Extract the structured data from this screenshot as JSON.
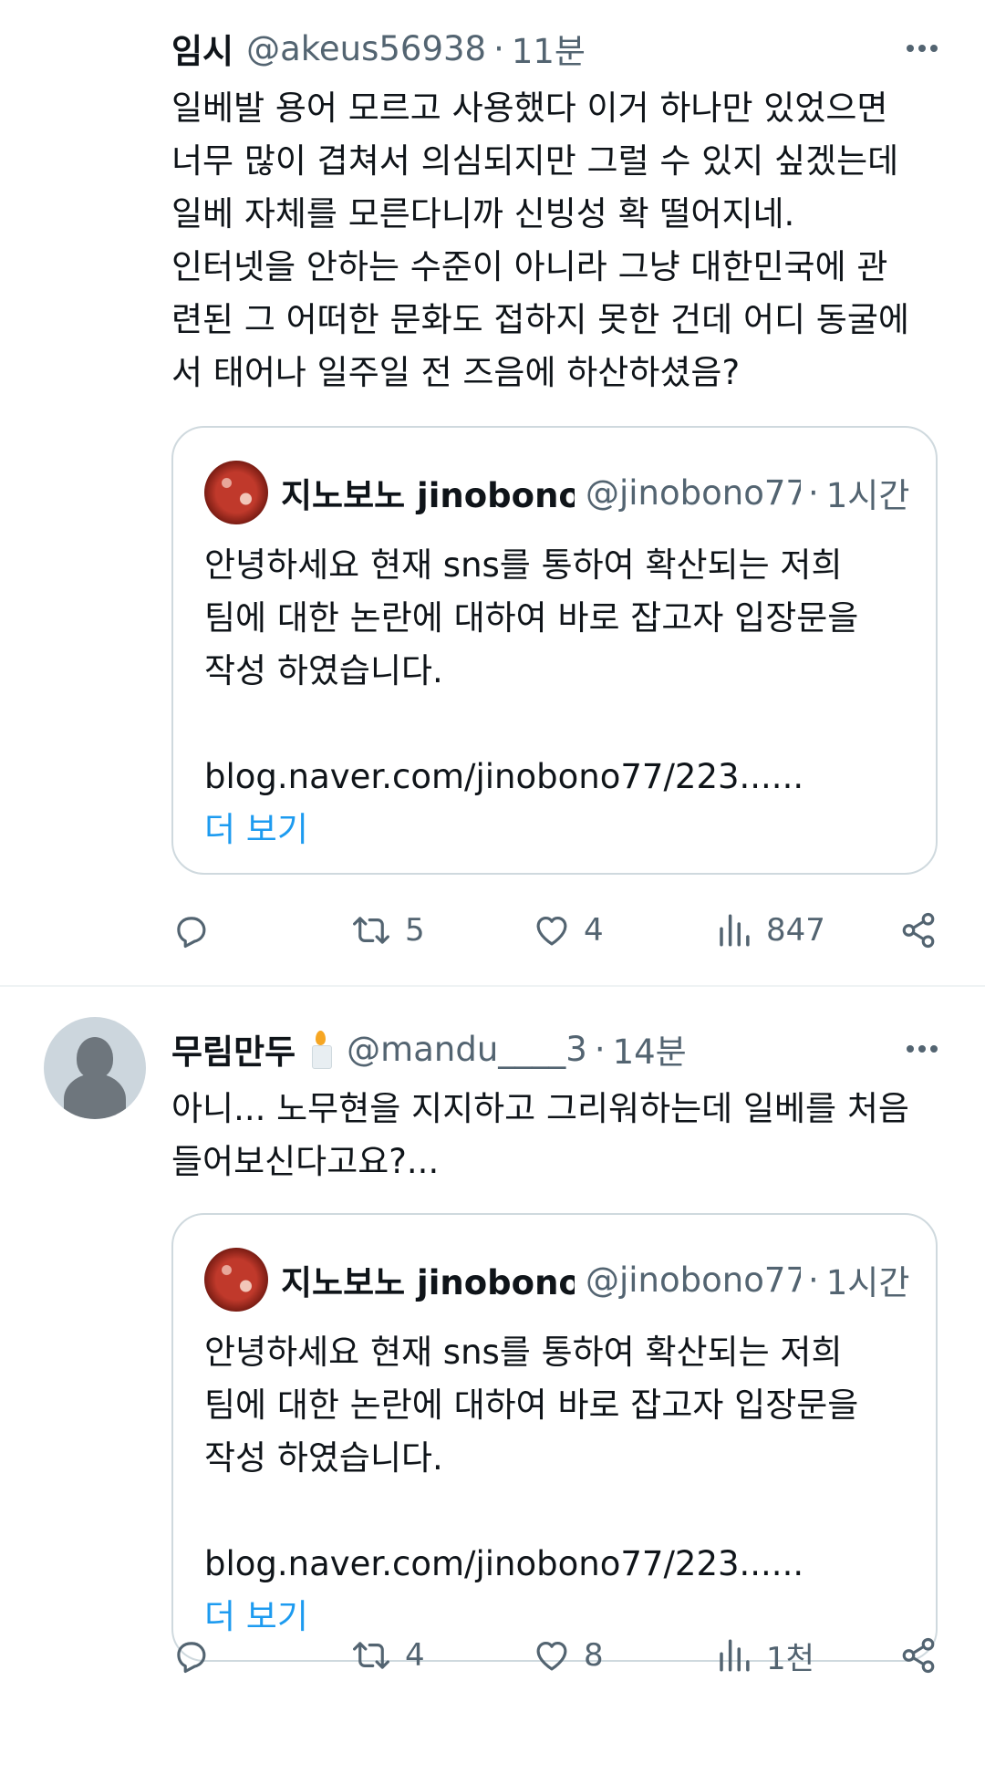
{
  "tweets": [
    {
      "name": "임시",
      "handle": "@akeus56938",
      "separator": "·",
      "time": "11분",
      "text_lines": [
        "일베발 용어 모르고 사용했다 이거 하나만 있었으면",
        "너무 많이 겹쳐서 의심되지만 그럴 수 있지 싶겠는데",
        "일베 자체를 모른다니까 신빙성 확 떨어지네.",
        "인터넷을 안하는 수준이 아니라 그냥 대한민국에 관",
        "련된 그 어떠한 문화도 접하지 못한 건데 어디 동굴에",
        "서 태어나 일주일 전 즈음에 하산하셨음?"
      ],
      "quote": {
        "name": "지노보노 jinobono",
        "handle": "@jinobono77",
        "separator": "·",
        "time": "1시간",
        "text_lines": [
          "안녕하세요 현재 sns를 통하여 확산되는 저희",
          "팀에 대한 논란에 대하여 바로 잡고자 입장문을",
          "작성 하였습니다."
        ],
        "link": "blog.naver.com/jinobono77/223......",
        "more": "더 보기"
      },
      "stats": {
        "retweets": "5",
        "likes": "4",
        "views": "847"
      }
    },
    {
      "name": "무림만두",
      "handle": "@mandu____3",
      "separator": "·",
      "time": "14분",
      "text_lines": [
        "아니... 노무현을 지지하고 그리워하는데 일베를 처음",
        "들어보신다고요?..."
      ],
      "quote": {
        "name": "지노보노 jinobono",
        "handle": "@jinobono77",
        "separator": "·",
        "time": "1시간",
        "text_lines": [
          "안녕하세요 현재 sns를 통하여 확산되는 저희",
          "팀에 대한 논란에 대하여 바로 잡고자 입장문을",
          "작성 하였습니다."
        ],
        "link": "blog.naver.com/jinobono77/223......",
        "more": "더 보기"
      },
      "stats": {
        "retweets": "4",
        "likes": "8",
        "views": "1천"
      }
    }
  ],
  "icons": {
    "more": "more-horizontal-icon",
    "reply": "reply-icon",
    "retweet": "retweet-icon",
    "like": "heart-icon",
    "views": "views-bar-chart-icon",
    "share": "share-icon",
    "emoji": "candle-emoji"
  },
  "colors": {
    "text": "#0f1419",
    "secondary": "#536471",
    "link": "#1d9bf0",
    "border": "#cfd9de"
  }
}
